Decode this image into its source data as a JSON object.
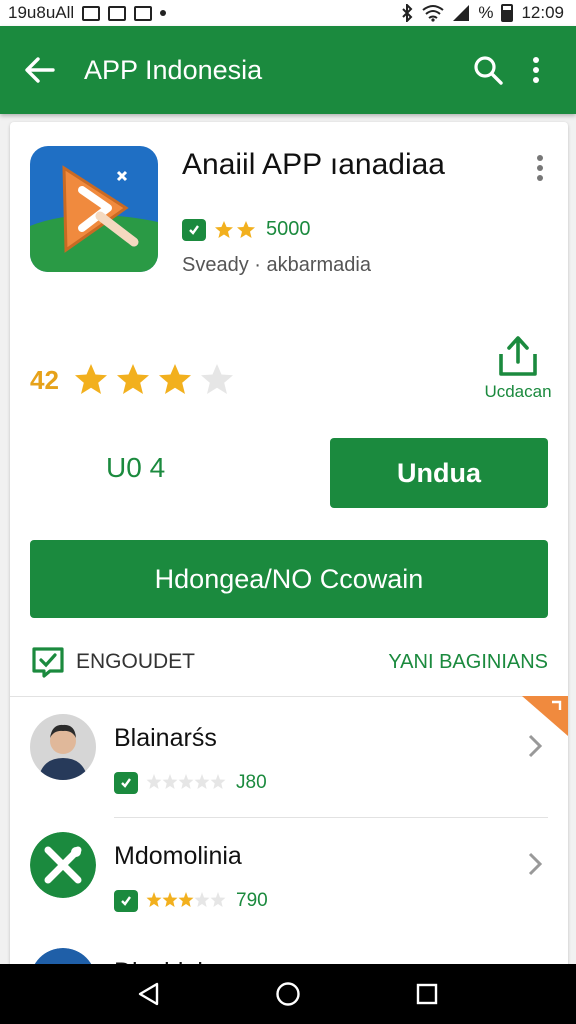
{
  "status_bar": {
    "carrier": "19u8uAll",
    "percent": "%",
    "time": "12:09"
  },
  "app_bar": {
    "title": "APP Indonesia"
  },
  "app": {
    "name": "Anaiil APP ıanadiaa",
    "rating_count": "5000",
    "developer": "Sveady · akbarmadia",
    "rating_value": "42",
    "rating_stars": 3,
    "share_label": "Ucdacan",
    "version": "U0 4",
    "install_label": "Undua",
    "wide_button_label": "Hdongea/NO Ccowain"
  },
  "section": {
    "title": "ENGOUDET",
    "link": "YANI BAGINIANS"
  },
  "list": [
    {
      "title": "Blainarśs",
      "count": "J80",
      "stars": 0
    },
    {
      "title": "Mdomolinia",
      "count": "790",
      "stars": 3
    },
    {
      "title": "Dlavhiair",
      "count": "",
      "stars": 0
    }
  ],
  "colors": {
    "primary": "#1b8a3e",
    "star": "#f2b01e",
    "accent_orange": "#f08a3e"
  }
}
